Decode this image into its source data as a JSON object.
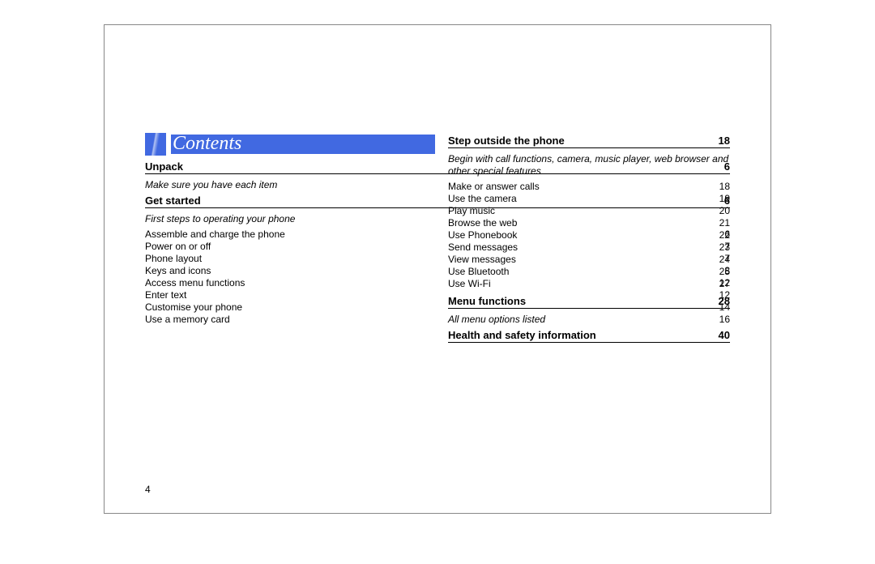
{
  "title": "Contents",
  "pageNumber": "4",
  "leftSections": [
    {
      "heading": "Unpack",
      "page": "6",
      "sub": "Make sure you have each item",
      "items": []
    },
    {
      "heading": "Get started",
      "page": "6",
      "sub": "First steps to operating your phone",
      "items": [
        {
          "label": "Assemble and charge the phone ",
          "page": "6"
        },
        {
          "label": "Power on or off",
          "page": "7"
        },
        {
          "label": "Phone layout",
          "page": "7"
        },
        {
          "label": "Keys and icons",
          "page": "8"
        },
        {
          "label": "Access menu functions ",
          "page": "12"
        },
        {
          "label": "Enter text ",
          "page": "12"
        },
        {
          "label": "Customise your phone",
          "page": "14"
        },
        {
          "label": "Use a memory card",
          "page": "16"
        }
      ]
    }
  ],
  "rightSections": [
    {
      "heading": "Step outside the phone",
      "page": "18",
      "sub": "Begin with call functions, camera, music player, web browser and other special features",
      "items": [
        {
          "label": "Make or answer calls",
          "page": "18"
        },
        {
          "label": "Use the camera",
          "page": "19"
        },
        {
          "label": "Play music",
          "page": "20"
        },
        {
          "label": "Browse the web ",
          "page": "21"
        },
        {
          "label": "Use Phonebook ",
          "page": "22"
        },
        {
          "label": "Send messages",
          "page": "23"
        },
        {
          "label": "View messages ",
          "page": "24"
        },
        {
          "label": "Use Bluetooth ",
          "page": "25"
        },
        {
          "label": "Use Wi-Fi ",
          "page": "27"
        }
      ]
    },
    {
      "heading": "Menu functions",
      "page": "28",
      "sub": "All menu options listed",
      "items": []
    },
    {
      "heading": "Health and safety information",
      "page": "40",
      "sub": "",
      "items": []
    }
  ]
}
